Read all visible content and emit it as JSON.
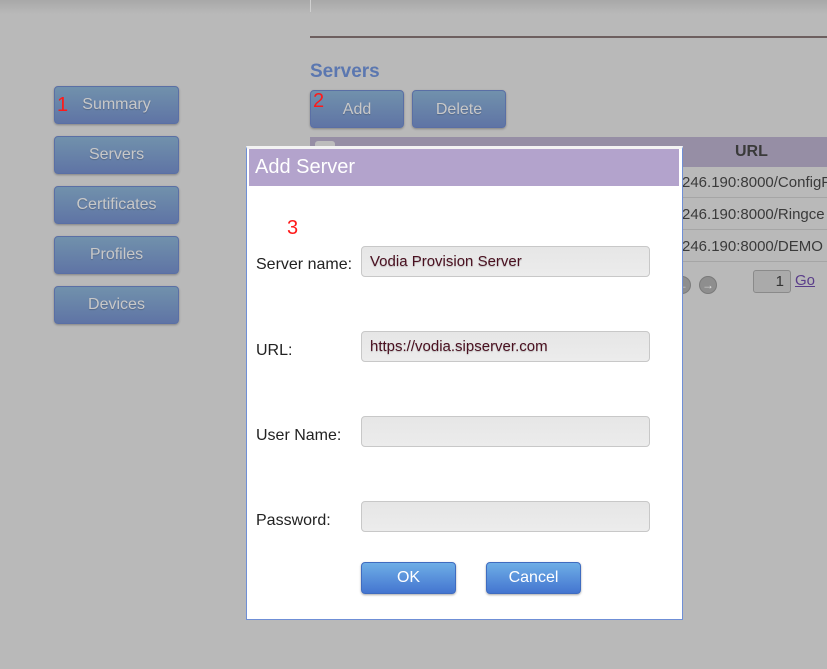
{
  "sidebar": {
    "items": [
      {
        "label": "Summary"
      },
      {
        "label": "Servers"
      },
      {
        "label": "Certificates"
      },
      {
        "label": "Profiles"
      },
      {
        "label": "Devices"
      }
    ]
  },
  "annotations": [
    "1",
    "2",
    "3"
  ],
  "main": {
    "title": "Servers",
    "add_label": "Add",
    "delete_label": "Delete",
    "table": {
      "columns": [
        "URL"
      ],
      "rows": [
        "246.190:8000/ConfigF",
        "246.190:8000/Ringce",
        "246.190:8000/DEMO"
      ]
    },
    "pager": {
      "page": "1",
      "go_label": "Go"
    }
  },
  "dialog": {
    "title": "Add Server",
    "fields": [
      {
        "label": "Server name:",
        "value": "Vodia Provision Server"
      },
      {
        "label": "URL:",
        "value": "https://vodia.sipserver.com"
      },
      {
        "label": "User Name:",
        "value": ""
      },
      {
        "label": "Password:",
        "value": ""
      }
    ],
    "ok_label": "OK",
    "cancel_label": "Cancel"
  },
  "colors": {
    "dialog_title_bg": "#b3a3cc",
    "button_blue": "#4475d0",
    "annotation": "#ff1a1a"
  }
}
